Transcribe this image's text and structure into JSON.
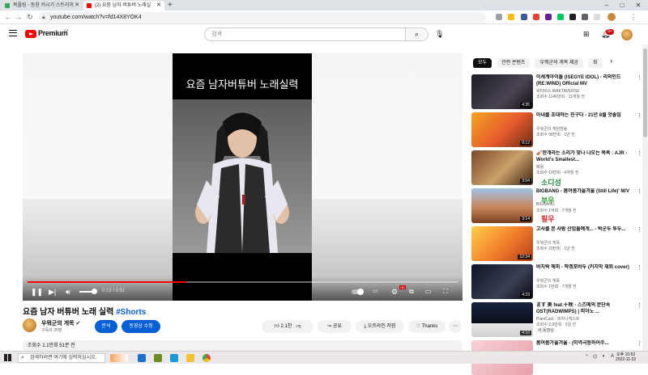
{
  "browser": {
    "tabs": [
      {
        "title": "목플링 - 동창 커시기 스트리미",
        "active": false
      },
      {
        "title": "(2) 요즘 남자 버튜버 노래실",
        "active": true
      }
    ],
    "new_tab": "+",
    "url": "youtube.com/watch?v=fd14X8YOK4",
    "window_controls": [
      "–",
      "□",
      "✕"
    ]
  },
  "youtube": {
    "logo_text": "Premium",
    "logo_region": "KR",
    "search_placeholder": "검색",
    "notification_count": "9+"
  },
  "player": {
    "frame_title": "요즘 남자버튜버 노래실력",
    "timecode": "0:19 / 0:51",
    "progress_fraction": 0.37,
    "volume_fraction": 0.75,
    "quality_badge": "HD"
  },
  "video": {
    "title": "요즘 남자 버튜버 노래 실력",
    "hashtag": "#Shorts",
    "channel": "우뭐군의 게목",
    "subscribers": "구독자 25명",
    "analytics_label": "분석",
    "edit_label": "동영상 수정",
    "likes": "2.1천",
    "share_label": "공유",
    "offline_label": "오프라인 저장",
    "thanks_label": "Thanks",
    "views_line": "조회수 1.1만회  51분 전"
  },
  "chips": [
    "모두",
    "관련 콘텐츠",
    "우뭐군의 게목 제공",
    "최"
  ],
  "recommendations": [
    {
      "title": "이세계아이돌 (ISEGYE IDOL) - 리와인드 (RE:WIND) Official MV",
      "channel": "왁타버스 WAKTAVERSE",
      "meta": "조회수 1146만회 · 11개월 전",
      "duration": "4:35",
      "thumb": "dark"
    },
    {
      "title": "아내를 초대하는 친구다 - 21년 8월 앗좋임",
      "channel": "우뭐군의 게임방송",
      "meta": "조회수 98만회 · 1년 전",
      "duration": "9:12",
      "thumb": "cartoon"
    },
    {
      "title": "🎻한개라는 소리가 맞나 나오는 목록 : AJR - World's Smallest...",
      "channel": "매몽",
      "meta": "조회수 10만회 · 4개월 전",
      "duration": "3:04",
      "thumb": "brown"
    },
    {
      "title": "BIGBANG - 봄여름가을겨울 (Still Life)' M/V",
      "channel": "BIGBANG",
      "meta": "조회수 1억회 · 7개월 전",
      "duration": "3:14",
      "thumb": "canyon"
    },
    {
      "title": "고사를 본 사람 산업들예게... - 박군두 투두...",
      "channel": "우뭐군의 게목",
      "meta": "조회수 20만회 · 1년 전",
      "duration": "12:34",
      "thumb": "cartoon2"
    },
    {
      "title": "바지락 해피 - 딱겡포바두 (커지막 재회 cover)",
      "channel": "우뭐군의 게목",
      "meta": "조회수 1만회 · 7개월 전",
      "duration": "4:23",
      "thumb": "night"
    },
    {
      "title": "ます 美 feat.十咲 - 스즈메의 문단속 OST(RADWIMPS) | 피아노 ...",
      "channel": "PianiCast · 피아니캐스트",
      "meta": "조회수 2.9만회 · 5일 전",
      "badge": "새 동영상",
      "duration": "4:10",
      "thumb": "piano"
    },
    {
      "title": "봄여름가을겨울 - (미역극등하어주...",
      "channel": "",
      "meta": "",
      "duration": "",
      "thumb": "pink"
    }
  ],
  "overlays": [
    {
      "text": "소디성",
      "color": "#1e8a3e"
    },
    {
      "text": "부우",
      "color": "#2a9d2a"
    },
    {
      "text": "필우",
      "color": "#d02020"
    }
  ],
  "taskbar": {
    "search_placeholder": "검색하려면 여기에 입력하십시오.",
    "time": "오후 10:52",
    "date": "2022-11-22",
    "lang": "A"
  }
}
